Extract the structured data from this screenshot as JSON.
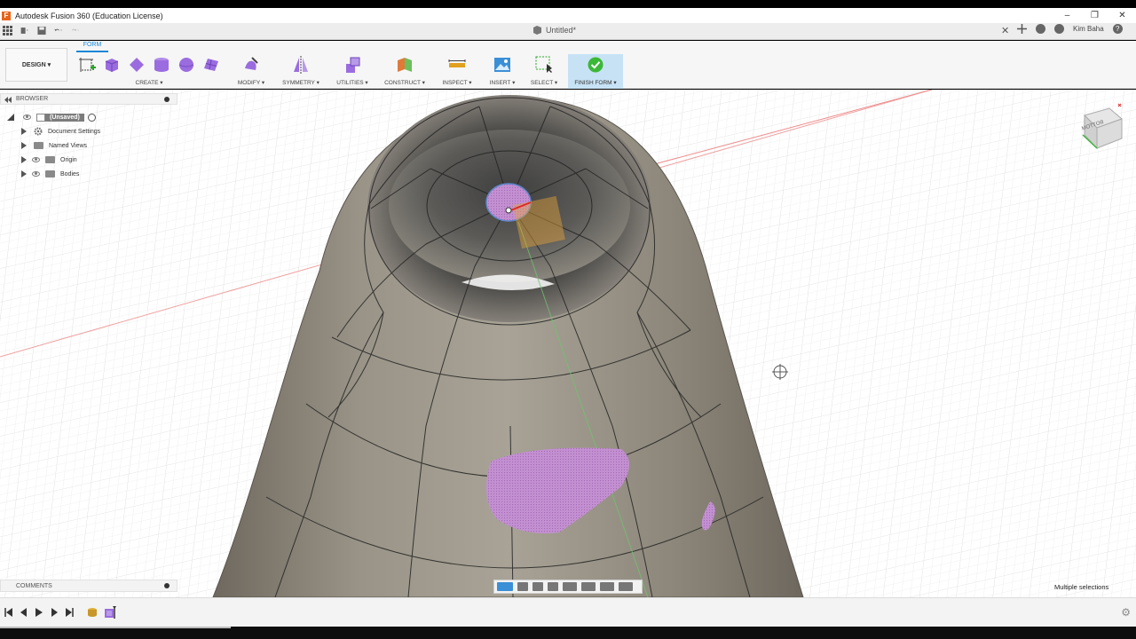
{
  "window": {
    "title": "Autodesk Fusion 360 (Education License)",
    "app_icon": "F",
    "controls": [
      "–",
      "❐",
      "✕"
    ]
  },
  "tabbar": {
    "doc_title": "Untitled*",
    "close": "✕",
    "user": "Kim Baha",
    "help": "?"
  },
  "toolbar": {
    "workspace_label": "DESIGN ▾",
    "active_tab": "FORM",
    "groups": {
      "create": "CREATE ▾",
      "modify": "MODIFY ▾",
      "symmetry": "SYMMETRY ▾",
      "utilities": "UTILITIES ▾",
      "construct": "CONSTRUCT ▾",
      "inspect": "INSPECT ▾",
      "insert": "INSERT ▾",
      "select": "SELECT ▾",
      "finish_form": "FINISH FORM ▾"
    }
  },
  "browser": {
    "header": "BROWSER",
    "items": [
      {
        "label": "(Unsaved)"
      },
      {
        "label": "Document Settings"
      },
      {
        "label": "Named Views"
      },
      {
        "label": "Origin"
      },
      {
        "label": "Bodies"
      }
    ]
  },
  "comments": {
    "header": "COMMENTS"
  },
  "status": {
    "selection": "Multiple selections"
  },
  "viewcube": {
    "face_label": "BOTTOM"
  },
  "colors": {
    "accent": "#1a87d8",
    "finish_bg": "#c7e2f5",
    "finish_check": "#3cb838",
    "form_purple": "#8a5bd6",
    "selection_pink": "#c78fd3",
    "body_grey": "#8c8578"
  }
}
